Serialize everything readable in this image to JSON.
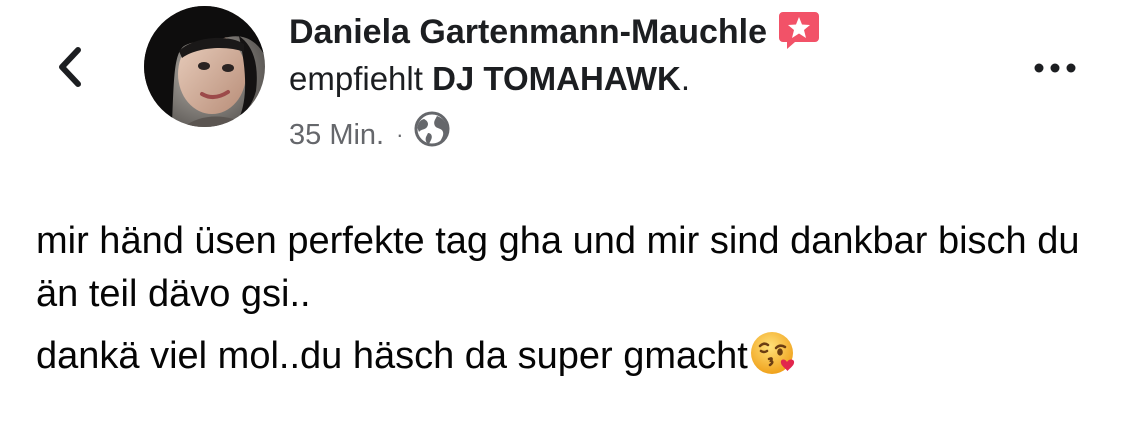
{
  "header": {
    "back_icon": "chevron-left-icon",
    "author_name": "Daniela Gartenmann-Mauchle",
    "recommend_badge_icon": "recommendation-star-icon",
    "recommend_verb": "empfiehlt",
    "recommended_page": "DJ TOMAHAWK",
    "recommend_suffix": ".",
    "timestamp": "35 Min.",
    "separator": "·",
    "privacy_icon": "globe-icon",
    "more_icon": "more-dots-icon"
  },
  "post": {
    "line1": "mir händ üsen perfekte tag gha und mir sind dankbar bisch du än teil dävo gsi..",
    "line2": "dankä viel mol..du häsch da super gmacht",
    "line2_emoji": "face-blowing-kiss-emoji"
  },
  "colors": {
    "text": "#1c1e21",
    "meta": "#65676b",
    "badge": "#f25268",
    "emoji_face": "#f7c13a",
    "heart": "#e2264d"
  }
}
